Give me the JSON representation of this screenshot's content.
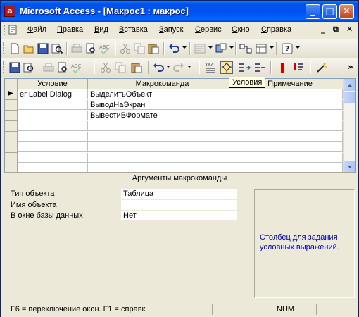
{
  "window": {
    "title": "Microsoft Access - [Макрос1 : макрос]",
    "minimize_glyph": "_",
    "maximize_glyph": "□",
    "close_glyph": "✕"
  },
  "menu": {
    "items": [
      "Файл",
      "Правка",
      "Вид",
      "Вставка",
      "Запуск",
      "Сервис",
      "Окно",
      "Справка"
    ],
    "mdi_min": "_",
    "mdi_restore": "⧉",
    "mdi_close": "✕"
  },
  "toolbar_top": {
    "icons": [
      "new-icon",
      "open-icon",
      "save-icon",
      "search-icon",
      "print-icon",
      "print-preview-icon",
      "spelling-icon",
      "cut-icon",
      "copy-icon",
      "paste-icon",
      "undo-icon",
      "analyze-icon",
      "office-links-icon",
      "relationships-icon",
      "new-object-icon",
      "help-icon"
    ]
  },
  "toolbar_bottom": {
    "icons": [
      "save-icon",
      "file-search-icon",
      "print-icon",
      "print-preview-icon",
      "spelling-icon",
      "cut-icon",
      "copy-icon",
      "paste-icon",
      "undo-icon",
      "redo-icon",
      "macro-names-icon",
      "conditions-icon",
      "insert-rows-icon",
      "delete-rows-icon",
      "run-icon",
      "single-step-icon",
      "build-icon"
    ],
    "tooltip": "Условия",
    "overflow": "»"
  },
  "grid": {
    "columns": [
      "Условие",
      "Макрокоманда",
      "Примечание"
    ],
    "rows": [
      {
        "condition": "er Label Dialog",
        "action": "ВыделитьОбъект",
        "comment": ""
      },
      {
        "condition": "",
        "action": "ВыводНаЭкран",
        "comment": ""
      },
      {
        "condition": "",
        "action": "ВывестиВФормате",
        "comment": ""
      }
    ],
    "current_row_marker": "▶"
  },
  "arguments": {
    "title": "Аргументы макрокоманды",
    "fields": [
      {
        "label": "Тип объекта",
        "value": "Таблица"
      },
      {
        "label": "Имя объекта",
        "value": ""
      },
      {
        "label": "В окне базы данных",
        "value": "Нет"
      }
    ],
    "hint": "Столбец для задания условных выражений."
  },
  "status": {
    "text": "F6 = переключение окон.  F1 = справк",
    "num": "NUM"
  },
  "colors": {
    "title_bar": "#0053ee",
    "hint_text": "#0000cc",
    "close_button": "#c7401c"
  }
}
